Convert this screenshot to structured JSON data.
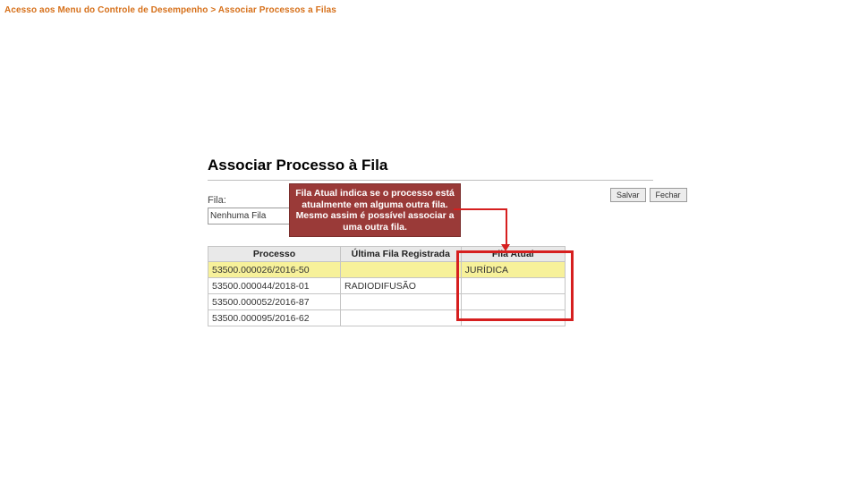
{
  "breadcrumb": "Acesso aos Menu do Controle de Desempenho > Associar Processos a Filas",
  "title": "Associar Processo à Fila",
  "field": {
    "label": "Fila:",
    "value": "Nenhuma Fila"
  },
  "buttons": {
    "save": "Salvar",
    "close": "Fechar"
  },
  "callout": "Fila Atual indica se o processo está atualmente em alguma outra fila. Mesmo assim é possível associar a uma outra fila.",
  "table": {
    "headers": {
      "processo": "Processo",
      "ultima": "Última Fila Registrada",
      "atual": "Fila Atual"
    },
    "rows": [
      {
        "processo": "53500.000026/2016-50",
        "ultima": "",
        "atual": "JURÍDICA",
        "highlight": true
      },
      {
        "processo": "53500.000044/2018-01",
        "ultima": "RADIODIFUSÃO",
        "atual": "",
        "highlight": false
      },
      {
        "processo": "53500.000052/2016-87",
        "ultima": "",
        "atual": "",
        "highlight": false
      },
      {
        "processo": "53500.000095/2016-62",
        "ultima": "",
        "atual": "",
        "highlight": false
      }
    ]
  }
}
